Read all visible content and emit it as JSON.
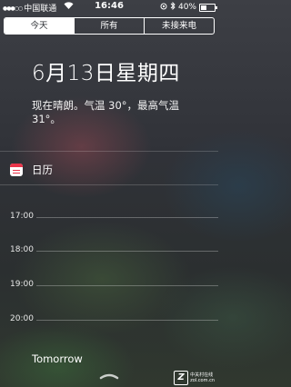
{
  "status_bar": {
    "carrier": "中国联通",
    "time": "16:46",
    "battery": "40%",
    "battery_level": 0.4
  },
  "tabs": [
    {
      "label": "今天",
      "active": true
    },
    {
      "label": "所有",
      "active": false
    },
    {
      "label": "未接来电",
      "active": false
    }
  ],
  "today": {
    "date_heading": "6月13日星期四",
    "weather_summary": "现在晴朗。气温 30°，最高气温 31°。"
  },
  "calendar": {
    "title": "日历",
    "icon": "calendar-icon",
    "hours": [
      "17:00",
      "18:00",
      "19:00",
      "20:00"
    ]
  },
  "tomorrow_label": "Tomorrow",
  "watermark": {
    "logo": "Z",
    "line1": "中关村在线",
    "line2": "zol.com.cn"
  },
  "colors": {
    "calendar_red": "#e8344a"
  }
}
